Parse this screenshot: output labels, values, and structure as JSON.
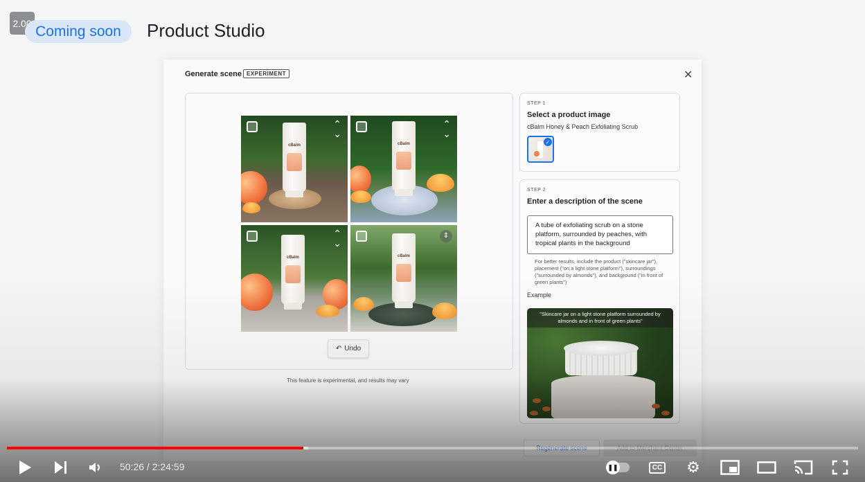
{
  "overlay": {
    "speed": "2.00",
    "badge": "Coming soon",
    "title": "Product Studio"
  },
  "dialog": {
    "title": "Generate scene",
    "badge": "EXPERIMENT",
    "undo": "Undo",
    "disclaimer": "This feature is experimental, and results may vary",
    "step1": {
      "label": "STEP 1",
      "title": "Select a product image",
      "product": "cBalm Honey & Peach Exfoliating Scrub"
    },
    "step2": {
      "label": "STEP 2",
      "title": "Enter a description of the scene",
      "description": "A tube of exfoliating scrub on a stone platform, surrounded by peaches, with tropical plants in the background",
      "hint": "For better results, include the product (\"skincare jar\"), placement (\"on a light stone platform\"), surroundings (\"surrounded by almonds\"), and background (\"in front of green plants\")",
      "example_label": "Example",
      "example_caption": "\"Skincare jar on a light stone platform surrounded by almonds and in front of green plants\""
    },
    "tube_brand": "cBalm",
    "footer": {
      "regenerate": "Regenerate scene",
      "merchant": "Add to Merchant Center"
    }
  },
  "player": {
    "time": "50:26 / 2:24:59",
    "progress_fraction": 0.348,
    "buffered_fraction": 0.354,
    "cc": "CC"
  },
  "colors": {
    "accent": "#1a73e8",
    "progress": "#ff0000"
  }
}
